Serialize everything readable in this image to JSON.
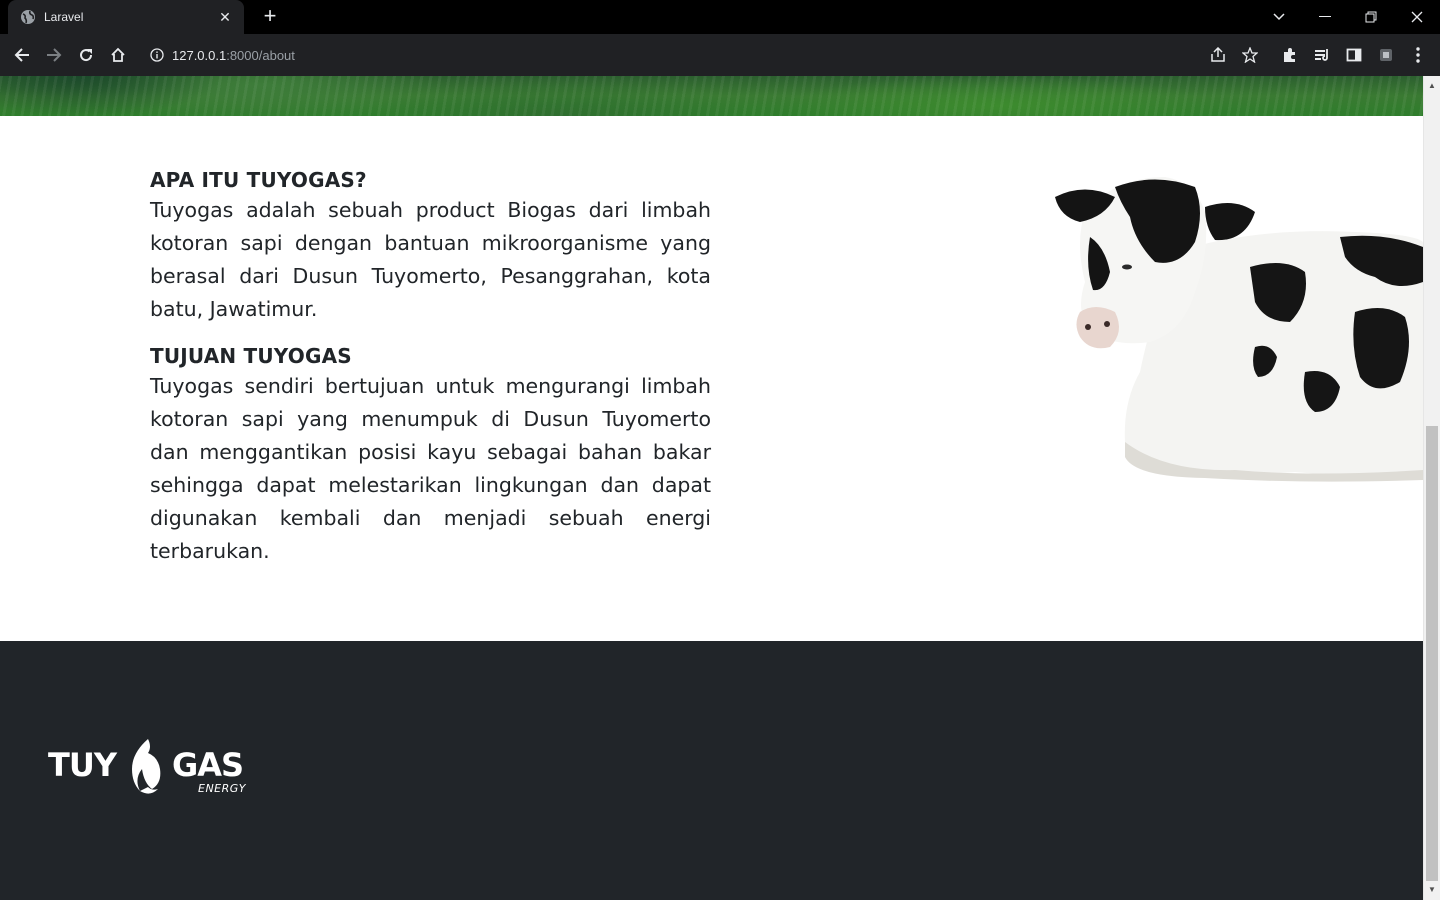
{
  "browser": {
    "tab_title": "Laravel",
    "url_host": "127.0.0.1",
    "url_path": ":8000/about"
  },
  "about": {
    "heading1": "APA ITU TUYOGAS?",
    "paragraph1": "Tuyogas adalah sebuah product Biogas dari limbah kotoran sapi dengan bantuan mikroorganisme yang berasal dari Dusun Tuyomerto, Pesanggrahan, kota batu, Jawatimur.",
    "heading2": "TUJUAN TUYOGAS",
    "paragraph2": "Tuyogas sendiri bertujuan untuk mengurangi limbah kotoran sapi yang menumpuk di Dusun Tuyomerto dan menggantikan posisi kayu sebagai bahan bakar sehingga dapat melestarikan lingkungan dan dapat digunakan kembali dan menjadi sebuah energi terbarukan."
  },
  "footer": {
    "logo_text_left": "TUY",
    "logo_text_right": "GAS",
    "logo_tagline": "ENERGY"
  },
  "colors": {
    "footer_bg": "#212529",
    "text": "#212529",
    "chrome_bg": "#202124"
  }
}
